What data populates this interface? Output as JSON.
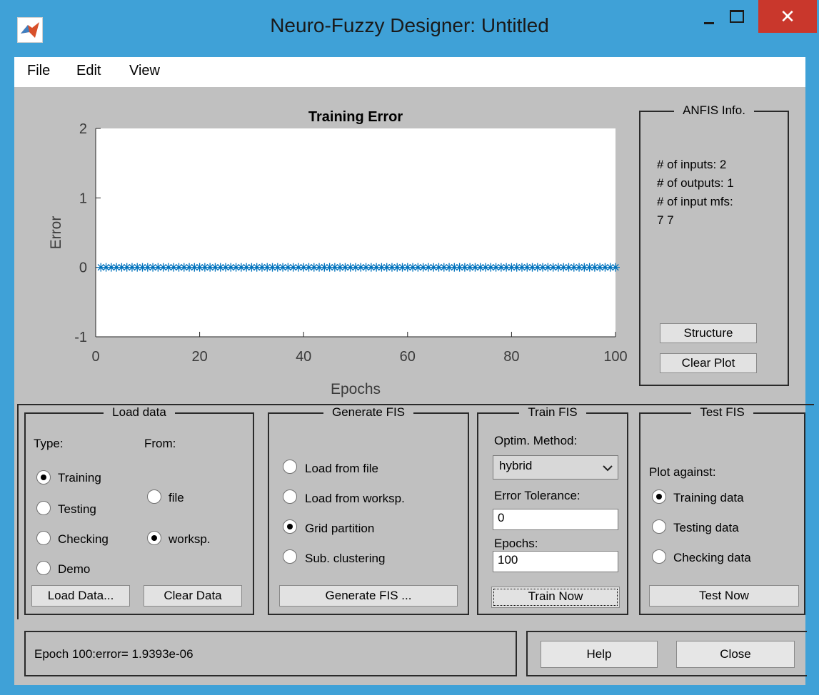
{
  "window": {
    "title": "Neuro-Fuzzy Designer: Untitled",
    "close_glyph": "✕"
  },
  "menu": [
    "File",
    "Edit",
    "View"
  ],
  "chart_data": {
    "type": "scatter",
    "title": "Training Error",
    "xlabel": "Epochs",
    "ylabel": "Error",
    "xlim": [
      0,
      100
    ],
    "ylim": [
      -1,
      2
    ],
    "x_ticks": [
      "0",
      "20",
      "40",
      "60",
      "80",
      "100"
    ],
    "y_ticks": [
      "2",
      "1",
      "0",
      "-1"
    ],
    "marker": "*",
    "color": "#0072bd",
    "series": [
      {
        "x_start": 1,
        "x_end": 100,
        "y": 1.9393e-06
      }
    ],
    "grid": false
  },
  "anfis_info": {
    "title": "ANFIS Info.",
    "inputs": "# of inputs: 2",
    "outputs": "# of outputs: 1",
    "input_mfs_label": "# of input mfs:",
    "input_mfs_value": "7  7",
    "structure_button": "Structure",
    "clear_plot_button": "Clear Plot"
  },
  "load_data": {
    "title": "Load data",
    "type_label": "Type:",
    "from_label": "From:",
    "types": [
      {
        "label": "Training",
        "selected": true
      },
      {
        "label": "Testing",
        "selected": false
      },
      {
        "label": "Checking",
        "selected": false
      },
      {
        "label": "Demo",
        "selected": false
      }
    ],
    "sources": [
      {
        "label": "file",
        "selected": false
      },
      {
        "label": "worksp.",
        "selected": true
      }
    ],
    "load_button": "Load Data...",
    "clear_button": "Clear Data"
  },
  "generate_fis": {
    "title": "Generate FIS",
    "options": [
      {
        "label": "Load from file",
        "selected": false
      },
      {
        "label": "Load from worksp.",
        "selected": false
      },
      {
        "label": "Grid partition",
        "selected": true
      },
      {
        "label": "Sub. clustering",
        "selected": false
      }
    ],
    "button": "Generate FIS ..."
  },
  "train_fis": {
    "title": "Train FIS",
    "method_label": "Optim. Method:",
    "method_value": "hybrid",
    "tolerance_label": "Error Tolerance:",
    "tolerance_value": "0",
    "epochs_label": "Epochs:",
    "epochs_value": "100",
    "button": "Train Now"
  },
  "test_fis": {
    "title": "Test FIS",
    "plot_against_label": "Plot against:",
    "options": [
      {
        "label": "Training data",
        "selected": true
      },
      {
        "label": "Testing data",
        "selected": false
      },
      {
        "label": "Checking data",
        "selected": false
      }
    ],
    "button": "Test Now"
  },
  "status": {
    "message": "Epoch 100:error= 1.9393e-06"
  },
  "footer": {
    "help_button": "Help",
    "close_button": "Close"
  }
}
